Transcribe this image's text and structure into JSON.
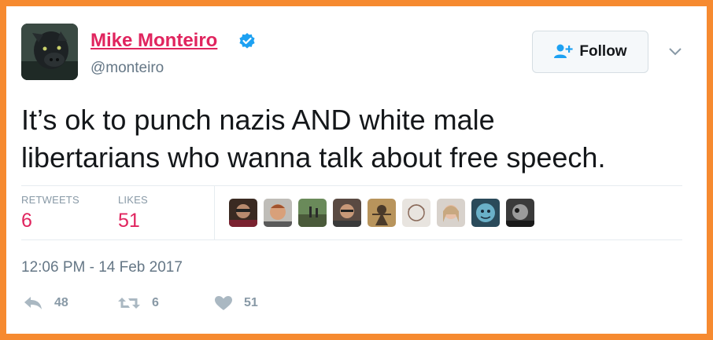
{
  "user": {
    "name": "Mike Monteiro",
    "handle": "@monteiro",
    "verified": true
  },
  "follow_button": {
    "label": "Follow",
    "icon": "add-user-icon"
  },
  "tweet": {
    "text_line1": "It’s ok to punch nazis AND white male",
    "text_line2": "libertarians who wanna talk about free speech."
  },
  "stats": {
    "retweets_label": "RETWEETS",
    "retweets_value": "6",
    "likes_label": "LIKES",
    "likes_value": "51"
  },
  "timestamp": "12:06 PM - 14 Feb 2017",
  "actions": {
    "reply_count": "48",
    "retweet_count": "6",
    "like_count": "51"
  },
  "colors": {
    "border": "#f68a30",
    "name": "#e0245e",
    "verified": "#1da1f2",
    "muted": "#657786",
    "light": "#8899a6"
  }
}
